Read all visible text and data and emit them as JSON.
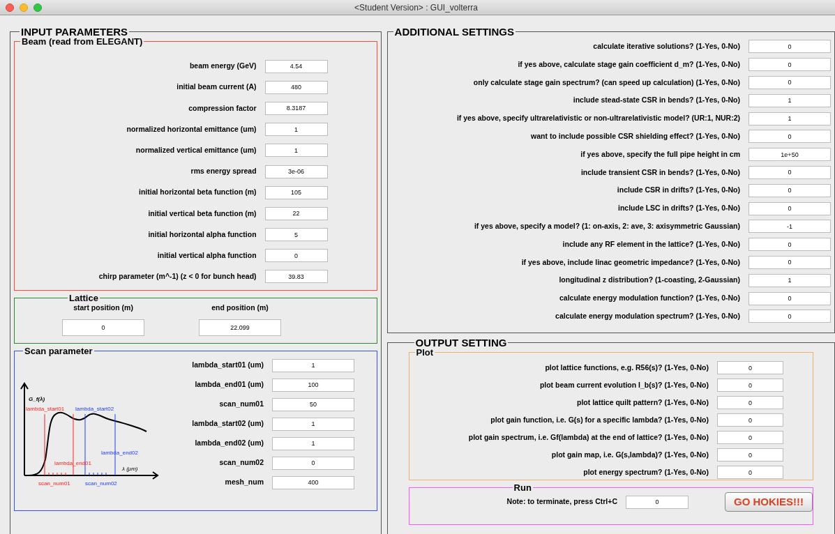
{
  "window": {
    "title": "<Student Version> : GUI_volterra"
  },
  "input_parameters": {
    "title": "INPUT PARAMETERS",
    "beam": {
      "title": "Beam (read from ELEGANT)",
      "fields": [
        {
          "label": "beam energy (GeV)",
          "value": "4.54"
        },
        {
          "label": "initial beam current (A)",
          "value": "480"
        },
        {
          "label": "compression factor",
          "value": "8.3187"
        },
        {
          "label": "normalized horizontal emittance (um)",
          "value": "1"
        },
        {
          "label": "normalized vertical emittance (um)",
          "value": "1"
        },
        {
          "label": "rms energy spread",
          "value": "3e-06"
        },
        {
          "label": "initial horizontal beta function (m)",
          "value": "105"
        },
        {
          "label": "initial vertical beta function (m)",
          "value": "22"
        },
        {
          "label": "initial horizontal alpha function",
          "value": "5"
        },
        {
          "label": "initial vertical alpha function",
          "value": "0"
        },
        {
          "label": "chirp parameter (m^-1) (z < 0 for bunch head)",
          "value": "39.83"
        }
      ]
    },
    "lattice": {
      "title": "Lattice",
      "fields": [
        {
          "label": "start position (m)",
          "value": "0"
        },
        {
          "label": "end position (m)",
          "value": "22.099"
        }
      ]
    },
    "scan": {
      "title": "Scan parameter",
      "fields": [
        {
          "label": "lambda_start01 (um)",
          "value": "1"
        },
        {
          "label": "lambda_end01 (um)",
          "value": "100"
        },
        {
          "label": "scan_num01",
          "value": "50"
        },
        {
          "label": "lambda_start02 (um)",
          "value": "1"
        },
        {
          "label": "lambda_end02 (um)",
          "value": "1"
        },
        {
          "label": "scan_num02",
          "value": "0"
        },
        {
          "label": "mesh_num",
          "value": "400"
        }
      ],
      "diagram": {
        "y_label": "G_f(λ)",
        "x_label": "λ (μm)",
        "start01": "lambda_start01",
        "end01": "lambda_end01",
        "scan01": "scan_num01",
        "start02": "lambda_start02",
        "end02": "lambda_end02",
        "scan02": "scan_num02"
      }
    }
  },
  "additional_settings": {
    "title": "ADDITIONAL SETTINGS",
    "fields": [
      {
        "label": "calculate iterative solutions? (1-Yes, 0-No)",
        "value": "0"
      },
      {
        "label": "if yes above, calculate stage gain coefficient d_m? (1-Yes, 0-No)",
        "value": "0"
      },
      {
        "label": "only calculate stage gain spectrum? (can speed up calculation) (1-Yes, 0-No)",
        "value": "0"
      },
      {
        "label": "include stead-state CSR in bends? (1-Yes, 0-No)",
        "value": "1"
      },
      {
        "label": "if yes above, specify ultrarelativistic or non-ultrarelativistic model? (UR:1, NUR:2)",
        "value": "1"
      },
      {
        "label": "want to include possible CSR shielding effect? (1-Yes, 0-No)",
        "value": "0"
      },
      {
        "label": "if yes above, specify the full pipe height in cm",
        "value": "1e+50"
      },
      {
        "label": "include transient CSR in bends? (1-Yes, 0-No)",
        "value": "0"
      },
      {
        "label": "include CSR in drifts? (1-Yes, 0-No)",
        "value": "0"
      },
      {
        "label": "include LSC in drifts? (1-Yes, 0-No)",
        "value": "0"
      },
      {
        "label": "if yes above, specify a model? (1: on-axis, 2: ave, 3: axisymmetric Gaussian)",
        "value": "-1"
      },
      {
        "label": "include any RF element in the lattice? (1-Yes, 0-No)",
        "value": "0"
      },
      {
        "label": "if yes above, include linac geometric impedance? (1-Yes, 0-No)",
        "value": "0"
      },
      {
        "label": "longitudinal z distribution? (1-coasting, 2-Gaussian)",
        "value": "1"
      },
      {
        "label": "calculate energy modulation function? (1-Yes, 0-No)",
        "value": "0"
      },
      {
        "label": "calculate energy modulation spectrum? (1-Yes, 0-No)",
        "value": "0"
      }
    ]
  },
  "output_setting": {
    "title": "OUTPUT SETTING",
    "plot": {
      "title": "Plot",
      "fields": [
        {
          "label": "plot lattice functions, e.g. R56(s)? (1-Yes, 0-No)",
          "value": "0"
        },
        {
          "label": "plot beam current evolution I_b(s)? (1-Yes, 0-No)",
          "value": "0"
        },
        {
          "label": "plot lattice quilt pattern? (1-Yes, 0-No)",
          "value": "0"
        },
        {
          "label": "plot gain function, i.e. G(s) for a specific lambda? (1-Yes, 0-No)",
          "value": "0"
        },
        {
          "label": "plot gain spectrum, i.e. Gf(lambda) at the end of lattice? (1-Yes, 0-No)",
          "value": "0"
        },
        {
          "label": "plot gain map, i.e. G(s,lambda)? (1-Yes, 0-No)",
          "value": "0"
        },
        {
          "label": "plot energy spectrum? (1-Yes, 0-No)",
          "value": "0"
        }
      ]
    },
    "run": {
      "title": "Run",
      "note": "Note: to terminate, press Ctrl+C",
      "value": "0",
      "button": "GO HOKIES!!!"
    }
  }
}
